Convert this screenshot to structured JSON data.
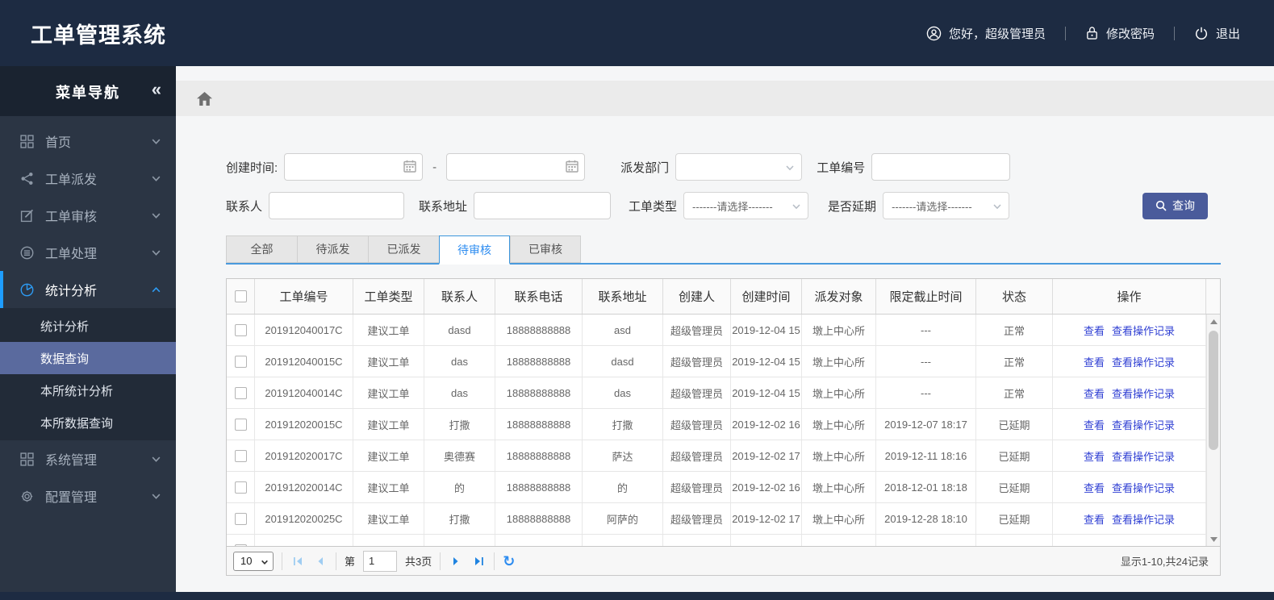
{
  "app": {
    "title": "工单管理系统"
  },
  "user_bar": {
    "greeting": "您好，超级管理员",
    "change_password": "修改密码",
    "logout": "退出"
  },
  "sidebar": {
    "title": "菜单导航",
    "collapse_icon": "«",
    "items": [
      {
        "label": "首页",
        "icon": "grid-icon",
        "expanded": false,
        "active": false
      },
      {
        "label": "工单派发",
        "icon": "share-icon",
        "expanded": false,
        "active": false
      },
      {
        "label": "工单审核",
        "icon": "edit-icon",
        "expanded": false,
        "active": false
      },
      {
        "label": "工单处理",
        "icon": "layers-icon",
        "expanded": false,
        "active": false
      },
      {
        "label": "统计分析",
        "icon": "pie-chart-icon",
        "expanded": true,
        "active": true,
        "children": [
          {
            "label": "统计分析",
            "active": false
          },
          {
            "label": "数据查询",
            "active": true
          },
          {
            "label": "本所统计分析",
            "active": false
          },
          {
            "label": "本所数据查询",
            "active": false
          }
        ]
      },
      {
        "label": "系统管理",
        "icon": "grid-icon",
        "expanded": false,
        "active": false
      },
      {
        "label": "配置管理",
        "icon": "gear-icon",
        "expanded": false,
        "active": false
      }
    ]
  },
  "filters": {
    "created_label": "创建时间:",
    "date_from_value": "",
    "date_to_value": "",
    "range_sep": "-",
    "dept_label": "派发部门",
    "dept_value": "",
    "order_no_label": "工单编号",
    "order_no_value": "",
    "contact_label": "联系人",
    "contact_value": "",
    "address_label": "联系地址",
    "address_value": "",
    "type_label": "工单类型",
    "type_value": "-------请选择-------",
    "delay_label": "是否延期",
    "delay_value": "-------请选择-------",
    "search_label": "查询"
  },
  "tabs": [
    {
      "label": "全部",
      "active": false
    },
    {
      "label": "待派发",
      "active": false
    },
    {
      "label": "已派发",
      "active": false
    },
    {
      "label": "待审核",
      "active": true
    },
    {
      "label": "已审核",
      "active": false
    }
  ],
  "table": {
    "columns": [
      "工单编号",
      "工单类型",
      "联系人",
      "联系电话",
      "联系地址",
      "创建人",
      "创建时间",
      "派发对象",
      "限定截止时间",
      "状态",
      "操作"
    ],
    "action_labels": [
      "查看",
      "查看操作记录"
    ],
    "rows": [
      {
        "checked": false,
        "order_no": "201912040017C",
        "type": "建议工单",
        "contact": "dasd",
        "phone": "18888888888",
        "address": "asd",
        "creator": "超级管理员",
        "created": "2019-12-04 15",
        "target": "墩上中心所",
        "deadline": "---",
        "status": "正常"
      },
      {
        "checked": false,
        "order_no": "201912040015C",
        "type": "建议工单",
        "contact": "das",
        "phone": "18888888888",
        "address": "dasd",
        "creator": "超级管理员",
        "created": "2019-12-04 15",
        "target": "墩上中心所",
        "deadline": "---",
        "status": "正常"
      },
      {
        "checked": false,
        "order_no": "201912040014C",
        "type": "建议工单",
        "contact": "das",
        "phone": "18888888888",
        "address": "das",
        "creator": "超级管理员",
        "created": "2019-12-04 15",
        "target": "墩上中心所",
        "deadline": "---",
        "status": "正常"
      },
      {
        "checked": false,
        "order_no": "201912020015C",
        "type": "建议工单",
        "contact": "打撒",
        "phone": "18888888888",
        "address": "打撒",
        "creator": "超级管理员",
        "created": "2019-12-02 16",
        "target": "墩上中心所",
        "deadline": "2019-12-07 18:17",
        "status": "已延期"
      },
      {
        "checked": false,
        "order_no": "201912020017C",
        "type": "建议工单",
        "contact": "奥德赛",
        "phone": "18888888888",
        "address": "萨达",
        "creator": "超级管理员",
        "created": "2019-12-02 17",
        "target": "墩上中心所",
        "deadline": "2019-12-11 18:16",
        "status": "已延期"
      },
      {
        "checked": false,
        "order_no": "201912020014C",
        "type": "建议工单",
        "contact": "的",
        "phone": "18888888888",
        "address": "的",
        "creator": "超级管理员",
        "created": "2019-12-02 16",
        "target": "墩上中心所",
        "deadline": "2018-12-01 18:18",
        "status": "已延期"
      },
      {
        "checked": false,
        "order_no": "201912020025C",
        "type": "建议工单",
        "contact": "打撒",
        "phone": "18888888888",
        "address": "阿萨的",
        "creator": "超级管理员",
        "created": "2019-12-02 17",
        "target": "墩上中心所",
        "deadline": "2019-12-28 18:10",
        "status": "已延期"
      }
    ]
  },
  "pagination": {
    "page_size": "10",
    "page_label": "第",
    "page_value": "1",
    "total_pages": "共3页",
    "summary": "显示1-10,共24记录"
  },
  "colors": {
    "header_bg": "#1d2b42",
    "accent_blue": "#2d8cf0",
    "link_blue": "#2f3fd3",
    "status_normal": "#2b50d8",
    "status_delayed": "#e02525",
    "search_button_bg": "#4a5b9b",
    "submenu_active_bg": "#5a6a9e"
  }
}
